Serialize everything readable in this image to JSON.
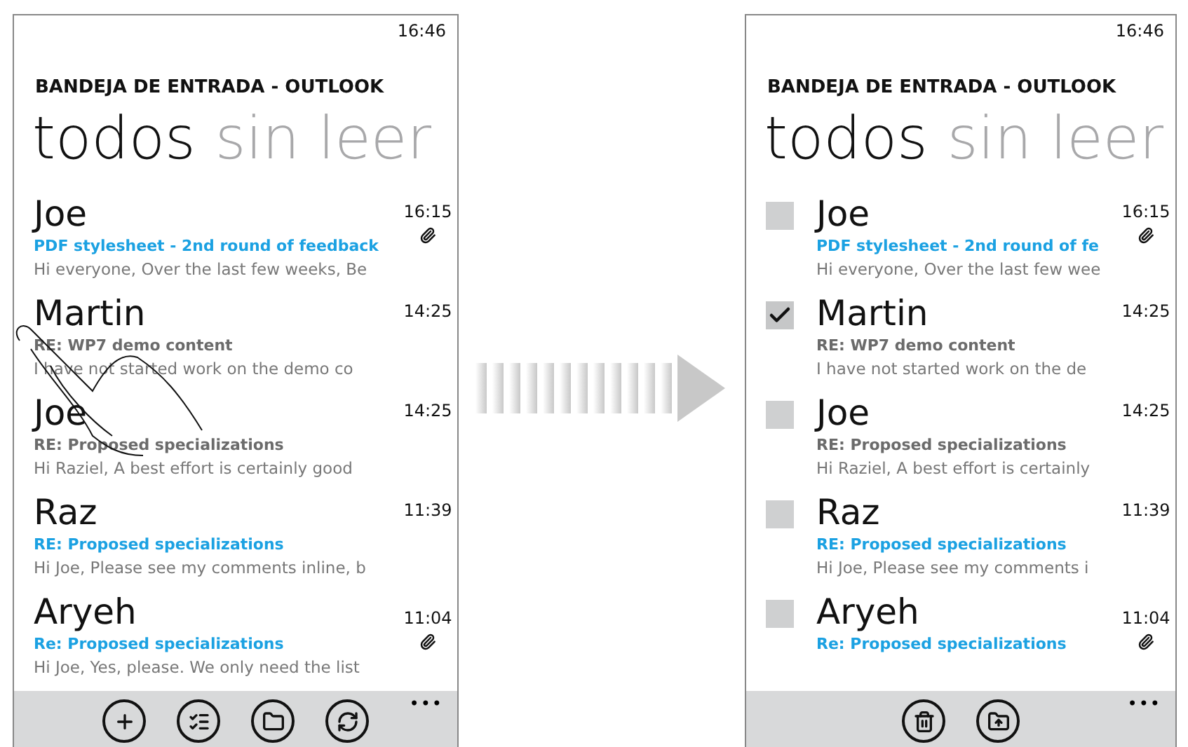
{
  "screens": [
    {
      "time": "16:46",
      "account": "BANDEJA DE ENTRADA - OUTLOOK",
      "pivots": [
        {
          "label": "todos",
          "selected": true
        },
        {
          "label": "sin leer",
          "selected": false
        }
      ],
      "select_mode": false,
      "touch": true,
      "more": "•••",
      "messages": [
        {
          "name": "Joe",
          "subject": "PDF stylesheet - 2nd round of feedback",
          "preview": "Hi everyone, Over the last few weeks, Be",
          "time": "16:15",
          "unread": true,
          "attachment": true
        },
        {
          "name": "Martin",
          "subject": "RE: WP7 demo content",
          "preview": "I have not started work on the demo co",
          "time": "14:25",
          "unread": false,
          "attachment": false
        },
        {
          "name": "Joe",
          "subject": "RE: Proposed specializations",
          "preview": "Hi Raziel, A best effort is certainly good",
          "time": "14:25",
          "unread": false,
          "attachment": false
        },
        {
          "name": "Raz",
          "subject": "RE: Proposed specializations",
          "preview": "Hi Joe, Please see my comments inline, b",
          "time": "11:39",
          "unread": true,
          "attachment": false
        },
        {
          "name": "Aryeh",
          "subject": "Re: Proposed specializations",
          "preview": "Hi Joe, Yes, please. We only need the list",
          "time": "11:04",
          "unread": true,
          "attachment": true
        }
      ],
      "app_bar": [
        {
          "kind": "add"
        },
        {
          "kind": "select"
        },
        {
          "kind": "folder"
        },
        {
          "kind": "sync"
        }
      ]
    },
    {
      "time": "16:46",
      "account": "BANDEJA DE ENTRADA - OUTLOOK",
      "pivots": [
        {
          "label": "todos",
          "selected": true
        },
        {
          "label": "sin leer",
          "selected": false
        }
      ],
      "select_mode": true,
      "touch": false,
      "more": "•••",
      "messages": [
        {
          "name": "Joe",
          "subject": "PDF stylesheet - 2nd round of fe",
          "preview": "Hi everyone, Over the last few wee",
          "time": "16:15",
          "unread": true,
          "attachment": true,
          "checked": false
        },
        {
          "name": "Martin",
          "subject": "RE: WP7 demo content",
          "preview": "I have not started work on the de",
          "time": "14:25",
          "unread": false,
          "attachment": false,
          "checked": true
        },
        {
          "name": "Joe",
          "subject": "RE: Proposed specializations",
          "preview": "Hi Raziel, A best effort is certainly",
          "time": "14:25",
          "unread": false,
          "attachment": false,
          "checked": false
        },
        {
          "name": "Raz",
          "subject": "RE: Proposed specializations",
          "preview": "Hi Joe, Please see my comments i",
          "time": "11:39",
          "unread": true,
          "attachment": false,
          "checked": false
        },
        {
          "name": "Aryeh",
          "subject": "Re: Proposed specializations",
          "time": "11:04",
          "unread": true,
          "attachment": true,
          "checked": false
        }
      ],
      "app_bar": [
        {
          "kind": "delete"
        },
        {
          "kind": "move"
        }
      ]
    }
  ]
}
